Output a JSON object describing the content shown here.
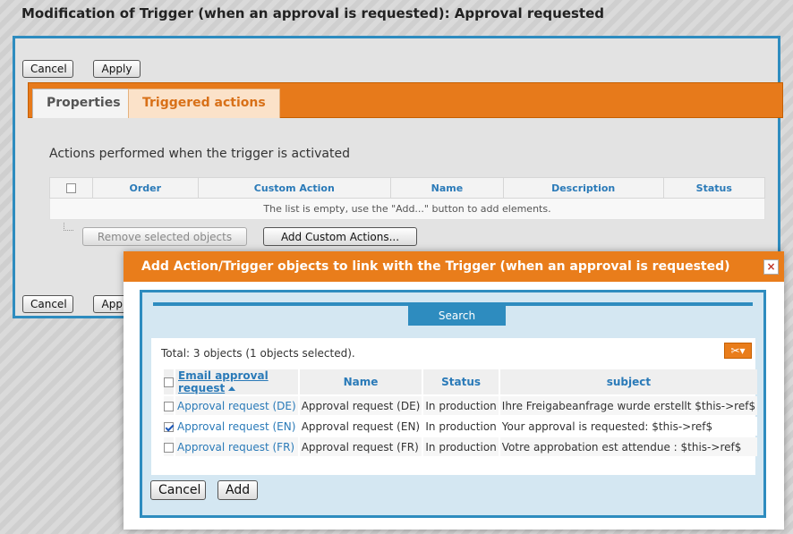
{
  "page": {
    "title": "Modification of Trigger (when an approval is requested): Approval requested"
  },
  "toolbar": {
    "cancel_label": "Cancel",
    "apply_label": "Apply"
  },
  "tabs": [
    {
      "label": "Properties"
    },
    {
      "label": "Triggered actions"
    }
  ],
  "actions_section": {
    "label": "Actions performed when the trigger is activated",
    "columns": [
      "Order",
      "Custom Action",
      "Name",
      "Description",
      "Status"
    ],
    "empty_message": "The list is empty, use the \"Add...\" button to add elements.",
    "remove_label": "Remove selected objects",
    "add_label": "Add Custom Actions..."
  },
  "bottom_toolbar": {
    "cancel_label": "Cancel",
    "apply_label": "Apply"
  },
  "modal": {
    "title": "Add Action/Trigger objects to link with the Trigger (when an approval is requested)",
    "close_symbol": "×",
    "search_tab_label": "Search",
    "total_text": "Total: 3 objects (1 objects selected).",
    "tools_icon": "✂▾",
    "columns": [
      "Email approval request",
      "Name",
      "Status",
      "subject"
    ],
    "rows": [
      {
        "checked": false,
        "email_approval_request": "Approval request (DE)",
        "name": "Approval request (DE)",
        "status": "In production",
        "subject": "Ihre Freigabeanfrage wurde erstellt $this->ref$"
      },
      {
        "checked": true,
        "email_approval_request": "Approval request (EN)",
        "name": "Approval request (EN)",
        "status": "In production",
        "subject": "Your approval is requested: $this->ref$"
      },
      {
        "checked": false,
        "email_approval_request": "Approval request (FR)",
        "name": "Approval request (FR)",
        "status": "In production",
        "subject": "Votre approbation est attendue : $this->ref$"
      }
    ],
    "cancel_label": "Cancel",
    "add_label": "Add"
  },
  "colors": {
    "accent_orange": "#e97d1b",
    "accent_blue": "#2e8cbf",
    "link_blue": "#2a7ab8"
  }
}
